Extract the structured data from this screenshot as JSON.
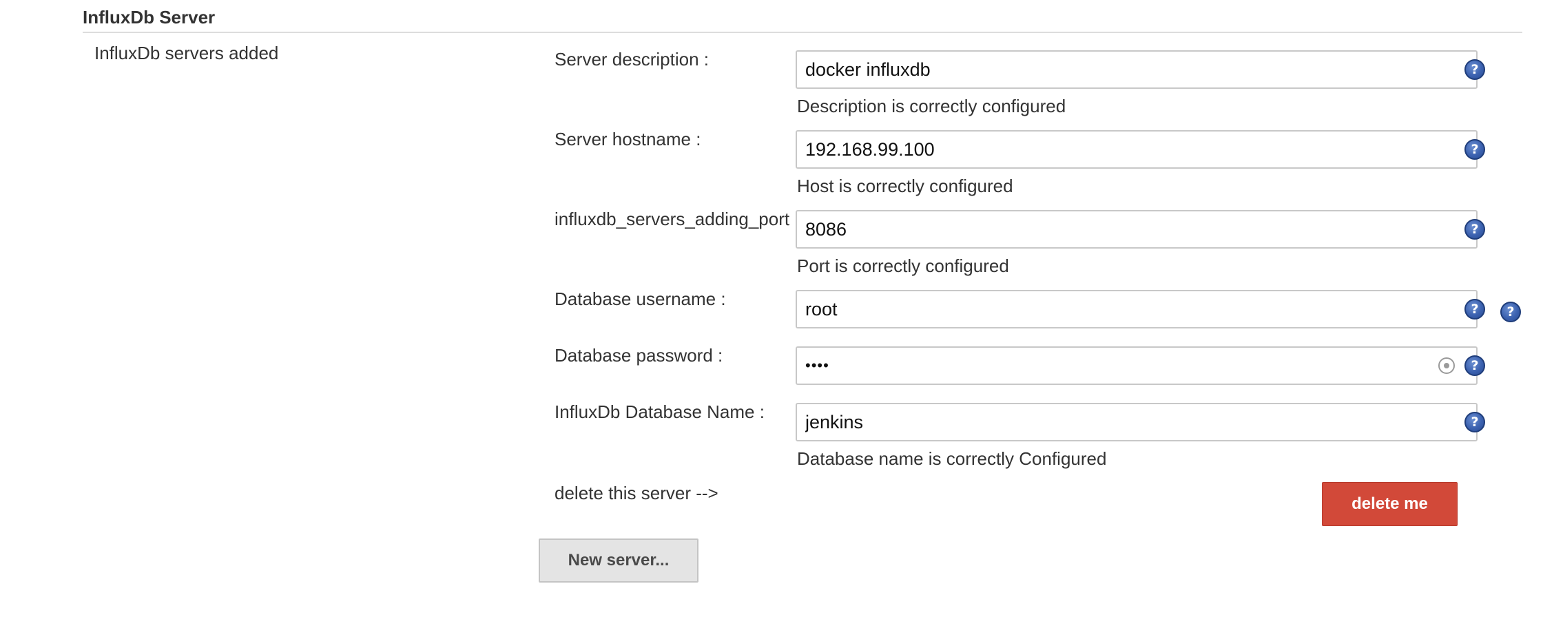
{
  "section": {
    "title": "InfluxDb Server",
    "servers_label": "InfluxDb servers added"
  },
  "fields": {
    "description": {
      "label": "Server description :",
      "value": "docker influxdb",
      "validation": "Description is correctly configured"
    },
    "hostname": {
      "label": "Server hostname :",
      "value": "192.168.99.100",
      "validation": "Host is correctly configured"
    },
    "port": {
      "label": "influxdb_servers_adding_port",
      "value": "8086",
      "validation": "Port is correctly configured"
    },
    "username": {
      "label": "Database username :",
      "value": "root"
    },
    "password": {
      "label": "Database password :",
      "value": "••••"
    },
    "database_name": {
      "label": "InfluxDb Database Name :",
      "value": "jenkins",
      "validation": "Database name is correctly Configured"
    }
  },
  "delete": {
    "label": "delete this server -->",
    "button_label": "delete me"
  },
  "new_server": {
    "button_label": "New server..."
  },
  "help": {
    "glyph": "?"
  },
  "colors": {
    "delete_button": "#d24939",
    "help_icon": "#3c62b0",
    "new_server_button": "#e4e4e4"
  }
}
